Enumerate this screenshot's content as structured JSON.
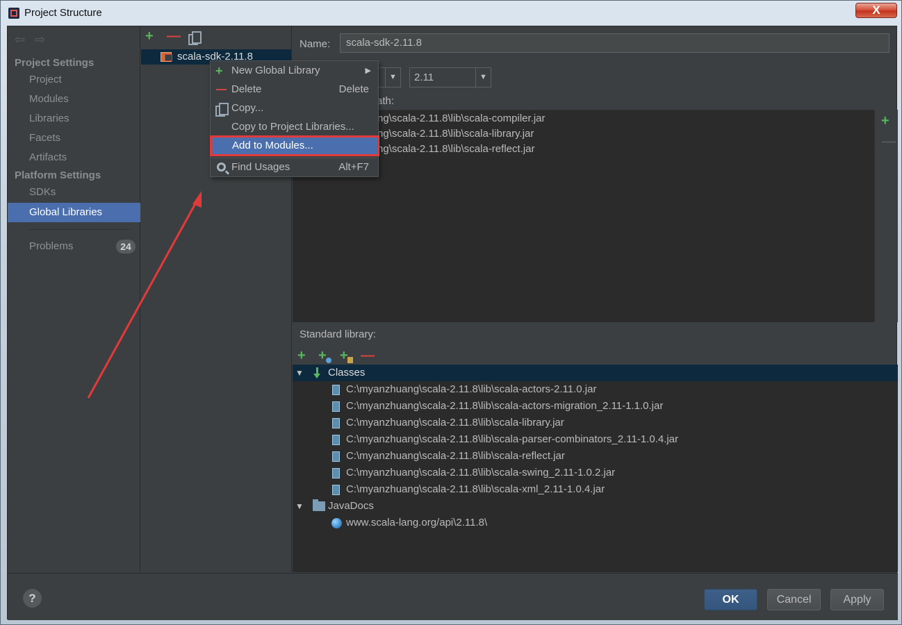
{
  "window": {
    "title": "Project Structure",
    "close_glyph": "X"
  },
  "nav": {
    "back_glyph": "⇦",
    "forward_glyph": "⇨",
    "project_settings": "Project Settings",
    "project_items": [
      "Project",
      "Modules",
      "Libraries",
      "Facets",
      "Artifacts"
    ],
    "platform_settings": "Platform Settings",
    "sdks": "SDKs",
    "global_libraries": "Global Libraries",
    "problems": "Problems",
    "problems_count": "24"
  },
  "library_list": {
    "selected": "scala-sdk-2.11.8"
  },
  "details": {
    "name_label": "Name:",
    "name_value": "scala-sdk-2.11.8",
    "version_value": "2.11",
    "compiler_paths": [
      "ng\\scala-2.11.8\\lib\\scala-compiler.jar",
      "ng\\scala-2.11.8\\lib\\scala-library.jar",
      "ng\\scala-2.11.8\\lib\\scala-reflect.jar"
    ],
    "compiler_path_label": "ath:",
    "standard_library_label": "Standard library:",
    "classes_label": "Classes",
    "classes": [
      "C:\\myanzhuang\\scala-2.11.8\\lib\\scala-actors-2.11.0.jar",
      "C:\\myanzhuang\\scala-2.11.8\\lib\\scala-actors-migration_2.11-1.1.0.jar",
      "C:\\myanzhuang\\scala-2.11.8\\lib\\scala-library.jar",
      "C:\\myanzhuang\\scala-2.11.8\\lib\\scala-parser-combinators_2.11-1.0.4.jar",
      "C:\\myanzhuang\\scala-2.11.8\\lib\\scala-reflect.jar",
      "C:\\myanzhuang\\scala-2.11.8\\lib\\scala-swing_2.11-1.0.2.jar",
      "C:\\myanzhuang\\scala-2.11.8\\lib\\scala-xml_2.11-1.0.4.jar"
    ],
    "javadocs_label": "JavaDocs",
    "javadocs": [
      "www.scala-lang.org/api\\2.11.8\\"
    ]
  },
  "context_menu": {
    "items": [
      {
        "label": "New Global Library",
        "shortcut": "",
        "icon": "plus-icon"
      },
      {
        "label": "Delete",
        "shortcut": "Delete",
        "icon": "minus-icon"
      },
      {
        "label": "Copy...",
        "shortcut": "",
        "icon": "copy-icon"
      },
      {
        "label": "Copy to Project Libraries...",
        "shortcut": "",
        "icon": ""
      },
      {
        "label": "Add to Modules...",
        "shortcut": "",
        "icon": ""
      },
      {
        "label": "Find Usages",
        "shortcut": "Alt+F7",
        "icon": "search-icon"
      }
    ],
    "highlighted": "Add to Modules..."
  },
  "buttons": {
    "help": "?",
    "ok": "OK",
    "cancel": "Cancel",
    "apply": "Apply"
  },
  "colors": {
    "selection": "#4b6eaf",
    "annotation": "#e23a3a",
    "background": "#3c3f41"
  }
}
